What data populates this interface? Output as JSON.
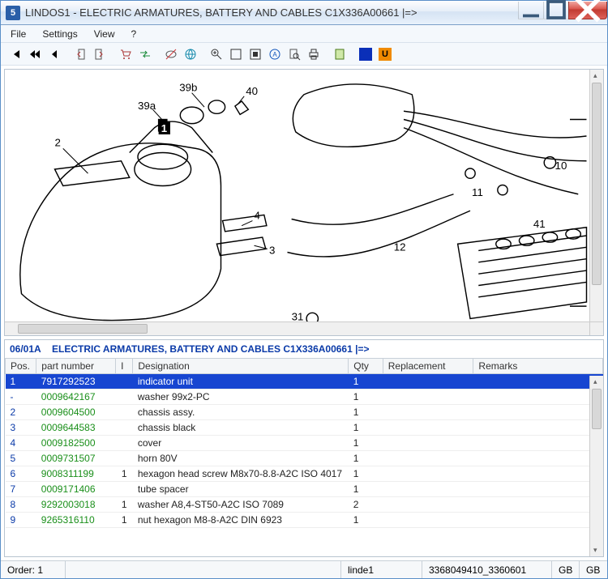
{
  "window": {
    "app_badge": "5",
    "title": "LINDOS1 - ELECTRIC ARMATURES, BATTERY AND CABLES C1X336A00661 |=>"
  },
  "menu": {
    "file": "File",
    "settings": "Settings",
    "view": "View",
    "help": "?"
  },
  "section": {
    "code": "06/01A",
    "title": "ELECTRIC ARMATURES, BATTERY AND CABLES C1X336A00661 |=>"
  },
  "callouts": {
    "c1": "1",
    "c2": "2",
    "c3": "3",
    "c4": "4",
    "c10": "10",
    "c11": "11",
    "c12": "12",
    "c31": "31",
    "c39a": "39a",
    "c39b": "39b",
    "c40": "40",
    "c41": "41"
  },
  "columns": {
    "pos": "Pos.",
    "pn": "part number",
    "i": "I",
    "des": "Designation",
    "qty": "Qty",
    "rep": "Replacement",
    "rem": "Remarks"
  },
  "rows": [
    {
      "pos": "1",
      "pn": "7917292523",
      "i": "",
      "des": "indicator unit",
      "qty": "1",
      "rep": "",
      "rem": "",
      "selected": true
    },
    {
      "pos": "-",
      "pn": "0009642167",
      "i": "",
      "des": "washer 99x2-PC",
      "qty": "1",
      "rep": "",
      "rem": ""
    },
    {
      "pos": "2",
      "pn": "0009604500",
      "i": "",
      "des": "chassis assy.",
      "qty": "1",
      "rep": "",
      "rem": ""
    },
    {
      "pos": "3",
      "pn": "0009644583",
      "i": "",
      "des": "chassis black",
      "qty": "1",
      "rep": "",
      "rem": ""
    },
    {
      "pos": "4",
      "pn": "0009182500",
      "i": "",
      "des": "cover",
      "qty": "1",
      "rep": "",
      "rem": ""
    },
    {
      "pos": "5",
      "pn": "0009731507",
      "i": "",
      "des": "horn 80V",
      "qty": "1",
      "rep": "",
      "rem": ""
    },
    {
      "pos": "6",
      "pn": "9008311199",
      "i": "1",
      "des": "hexagon head screw M8x70-8.8-A2C  ISO 4017",
      "qty": "1",
      "rep": "",
      "rem": ""
    },
    {
      "pos": "7",
      "pn": "0009171406",
      "i": "",
      "des": "tube spacer",
      "qty": "1",
      "rep": "",
      "rem": ""
    },
    {
      "pos": "8",
      "pn": "9292003018",
      "i": "1",
      "des": "washer A8,4-ST50-A2C  ISO 7089",
      "qty": "2",
      "rep": "",
      "rem": ""
    },
    {
      "pos": "9",
      "pn": "9265316110",
      "i": "1",
      "des": "nut hexagon M8-8-A2C  DIN 6923",
      "qty": "1",
      "rep": "",
      "rem": ""
    }
  ],
  "status": {
    "order": "Order: 1",
    "user": "linde1",
    "codes": "3368049410_3360601",
    "lang1": "GB",
    "lang2": "GB"
  }
}
